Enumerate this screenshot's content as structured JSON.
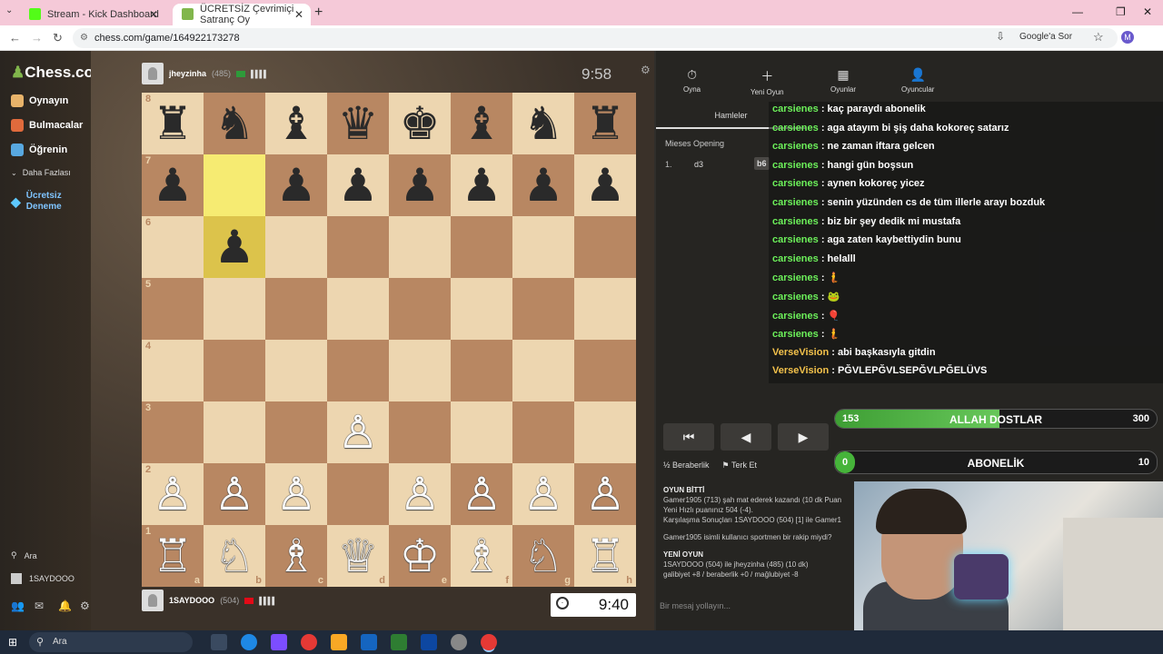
{
  "browser": {
    "tabs": [
      {
        "title": "Stream - Kick Dashboard"
      },
      {
        "title": "ÜCRETSİZ Çevrimiçi Satranç Oy"
      }
    ],
    "url": "chess.com/game/164922173278",
    "google_ask": "Google'a Sor",
    "profile_initial": "M"
  },
  "sidebar": {
    "logo": "Chess.com",
    "items": [
      {
        "label": "Oynayın",
        "icon": "play-icon",
        "color": "#e8b36a"
      },
      {
        "label": "Bulmacalar",
        "icon": "puzzle-icon",
        "color": "#e06a3c"
      },
      {
        "label": "Öğrenin",
        "icon": "learn-icon",
        "color": "#58a8e0"
      },
      {
        "label": "Daha Fazlası",
        "icon": "chevron-down-icon"
      },
      {
        "label": "Ücretsiz Deneme",
        "icon": "diamond-icon",
        "color": "#5ec8ff"
      }
    ],
    "search_label": "Ara",
    "user": "1SAYDOOO"
  },
  "game": {
    "top_player": {
      "name": "jheyzinha",
      "rating": "(485)",
      "clock": "9:58"
    },
    "bottom_player": {
      "name": "1SAYDOOO",
      "rating": "(504)",
      "clock": "9:40"
    },
    "board": [
      [
        "♜",
        "♞",
        "♝",
        "♛",
        "♚",
        "♝",
        "♞",
        "♜"
      ],
      [
        "♟",
        "",
        "♟",
        "♟",
        "♟",
        "♟",
        "♟",
        "♟"
      ],
      [
        "",
        "♟",
        "",
        "",
        "",
        "",
        "",
        ""
      ],
      [
        "",
        "",
        "",
        "",
        "",
        "",
        "",
        ""
      ],
      [
        "",
        "",
        "",
        "",
        "",
        "",
        "",
        ""
      ],
      [
        "",
        "",
        "",
        "♙",
        "",
        "",
        "",
        ""
      ],
      [
        "♙",
        "♙",
        "♙",
        "",
        "♙",
        "♙",
        "♙",
        "♙"
      ],
      [
        "♖",
        "♘",
        "♗",
        "♕",
        "♔",
        "♗",
        "♘",
        "♖"
      ]
    ],
    "ranks": [
      "8",
      "7",
      "6",
      "5",
      "4",
      "3",
      "2",
      "1"
    ],
    "files": [
      "a",
      "b",
      "c",
      "d",
      "e",
      "f",
      "g",
      "h"
    ],
    "highlight_squares": [
      "b7",
      "b6"
    ]
  },
  "panel": {
    "tabs": [
      {
        "label": "Oyna",
        "icon": "stopwatch-icon"
      },
      {
        "label": "Yeni Oyun",
        "icon": "plus-icon"
      },
      {
        "label": "Oyunlar",
        "icon": "games-icon"
      },
      {
        "label": "Oyuncular",
        "icon": "players-icon"
      }
    ],
    "moves_tab": "Hamleler",
    "opening": "Mieses Opening",
    "moves": [
      {
        "num": "1.",
        "white": "d3",
        "black": "b6"
      }
    ],
    "controls": [
      "⏮",
      "◀",
      "▶",
      "▷",
      "⏭"
    ],
    "draw": "Beraberlik",
    "resign": "Terk Et",
    "log": {
      "heading1": "OYUN BİTTİ",
      "line1": "Gamer1905 (713) şah mat ederek kazandı (10 dk Puan",
      "line2": "Yeni Hızlı puanınız 504 (-4).",
      "line3": "Karşılaşma Sonuçları 1SAYDOOO (504) [1] ile Gamer1",
      "line4": "Gamer1905 isimli kullanıcı sportmen bir rakip miydi?",
      "heading2": "YENİ OYUN",
      "line5": "1SAYDOOO (504) ile jheyzinha (485) (10 dk)",
      "line6": "galibiyet +8 / beraberlik +0 / mağlubiyet -8"
    },
    "message_placeholder": "Bir mesaj yollayın..."
  },
  "chat": [
    {
      "user": "carsienes",
      "text": "kaç paraydı abonelik"
    },
    {
      "user": "carsienes",
      "text": "aga atayım bi şiş daha kokoreç satarız"
    },
    {
      "user": "carsienes",
      "text": "ne zaman iftara gelcen"
    },
    {
      "user": "carsienes",
      "text": "hangi gün boşsun"
    },
    {
      "user": "carsienes",
      "text": "aynen kokoreç yicez"
    },
    {
      "user": "carsienes",
      "text": "senin yüzünden cs de tüm illerle arayı bozduk"
    },
    {
      "user": "carsienes",
      "text": "biz bir şey dedik mi mustafa"
    },
    {
      "user": "carsienes",
      "text": "aga zaten kaybettiydin bunu"
    },
    {
      "user": "carsienes",
      "text": "helalll"
    },
    {
      "user": "carsienes",
      "text": "🧜"
    },
    {
      "user": "carsienes",
      "text": "🐸"
    },
    {
      "user": "carsienes",
      "text": "🎈"
    },
    {
      "user": "carsienes",
      "text": "🧜"
    },
    {
      "user": "VerseVision",
      "text": "abi başkasıyla gitdin"
    },
    {
      "user": "VerseVision",
      "text": "PĞVLEPĞVLSEPĞVLPĞELÜVS"
    }
  ],
  "goals": [
    {
      "label": "ALLAH DOSTLAR",
      "current": "153",
      "target": "300",
      "progress": 0.51
    },
    {
      "label": "ABONELİK",
      "current": "0",
      "target": "10",
      "progress": 0.0
    }
  ],
  "taskbar": {
    "search": "Ara"
  }
}
